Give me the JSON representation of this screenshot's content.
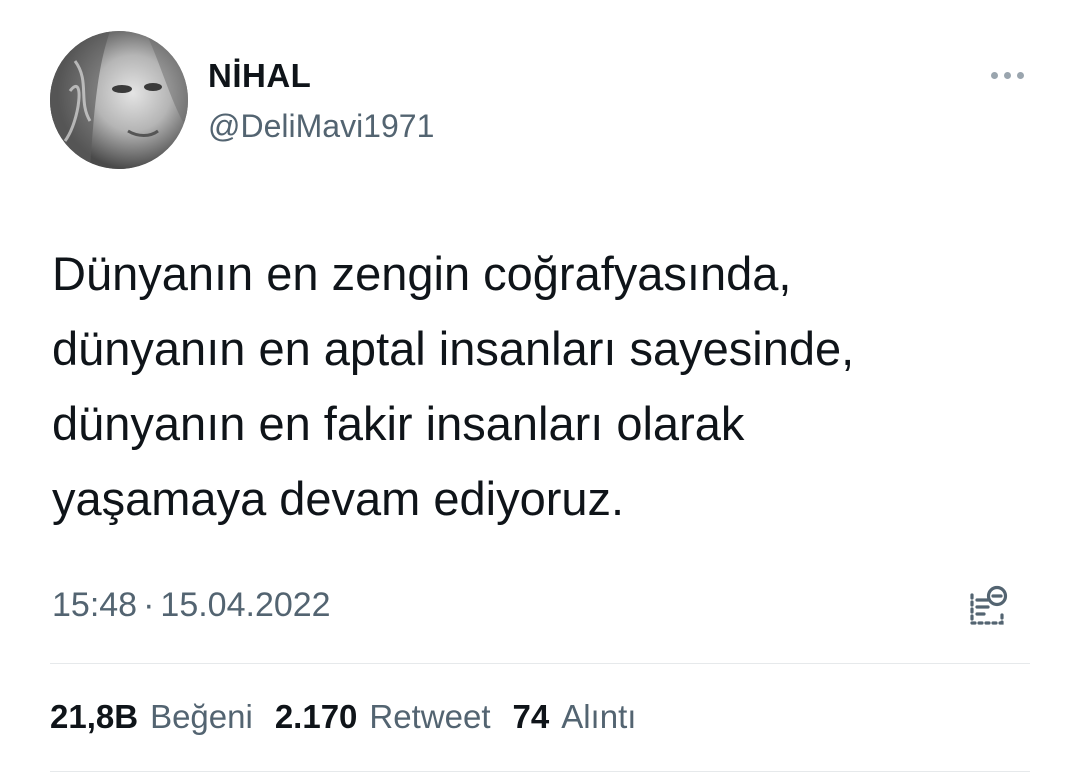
{
  "author": {
    "display_name": "NİHAL",
    "handle": "@DeliMavi1971"
  },
  "tweet": {
    "text": "Dünyanın en zengin coğrafyasında,\ndünyanın en aptal insanları sayesinde,\ndünyanın en fakir insanları olarak\nyaşamaya devam ediyoruz.",
    "time": "15:48",
    "separator": "·",
    "date": "15.04.2022"
  },
  "stats": {
    "likes_count": "21,8B",
    "likes_label": "Beğeni",
    "retweets_count": "2.170",
    "retweets_label": "Retweet",
    "quotes_count": "74",
    "quotes_label": "Alıntı"
  },
  "icons": {
    "avatar": "profile-photo",
    "more": "more-horizontal-icon",
    "source": "tweet-source-icon"
  },
  "colors": {
    "primary_text": "#0f1419",
    "secondary_text": "#536471",
    "divider": "#e6e9eb"
  }
}
